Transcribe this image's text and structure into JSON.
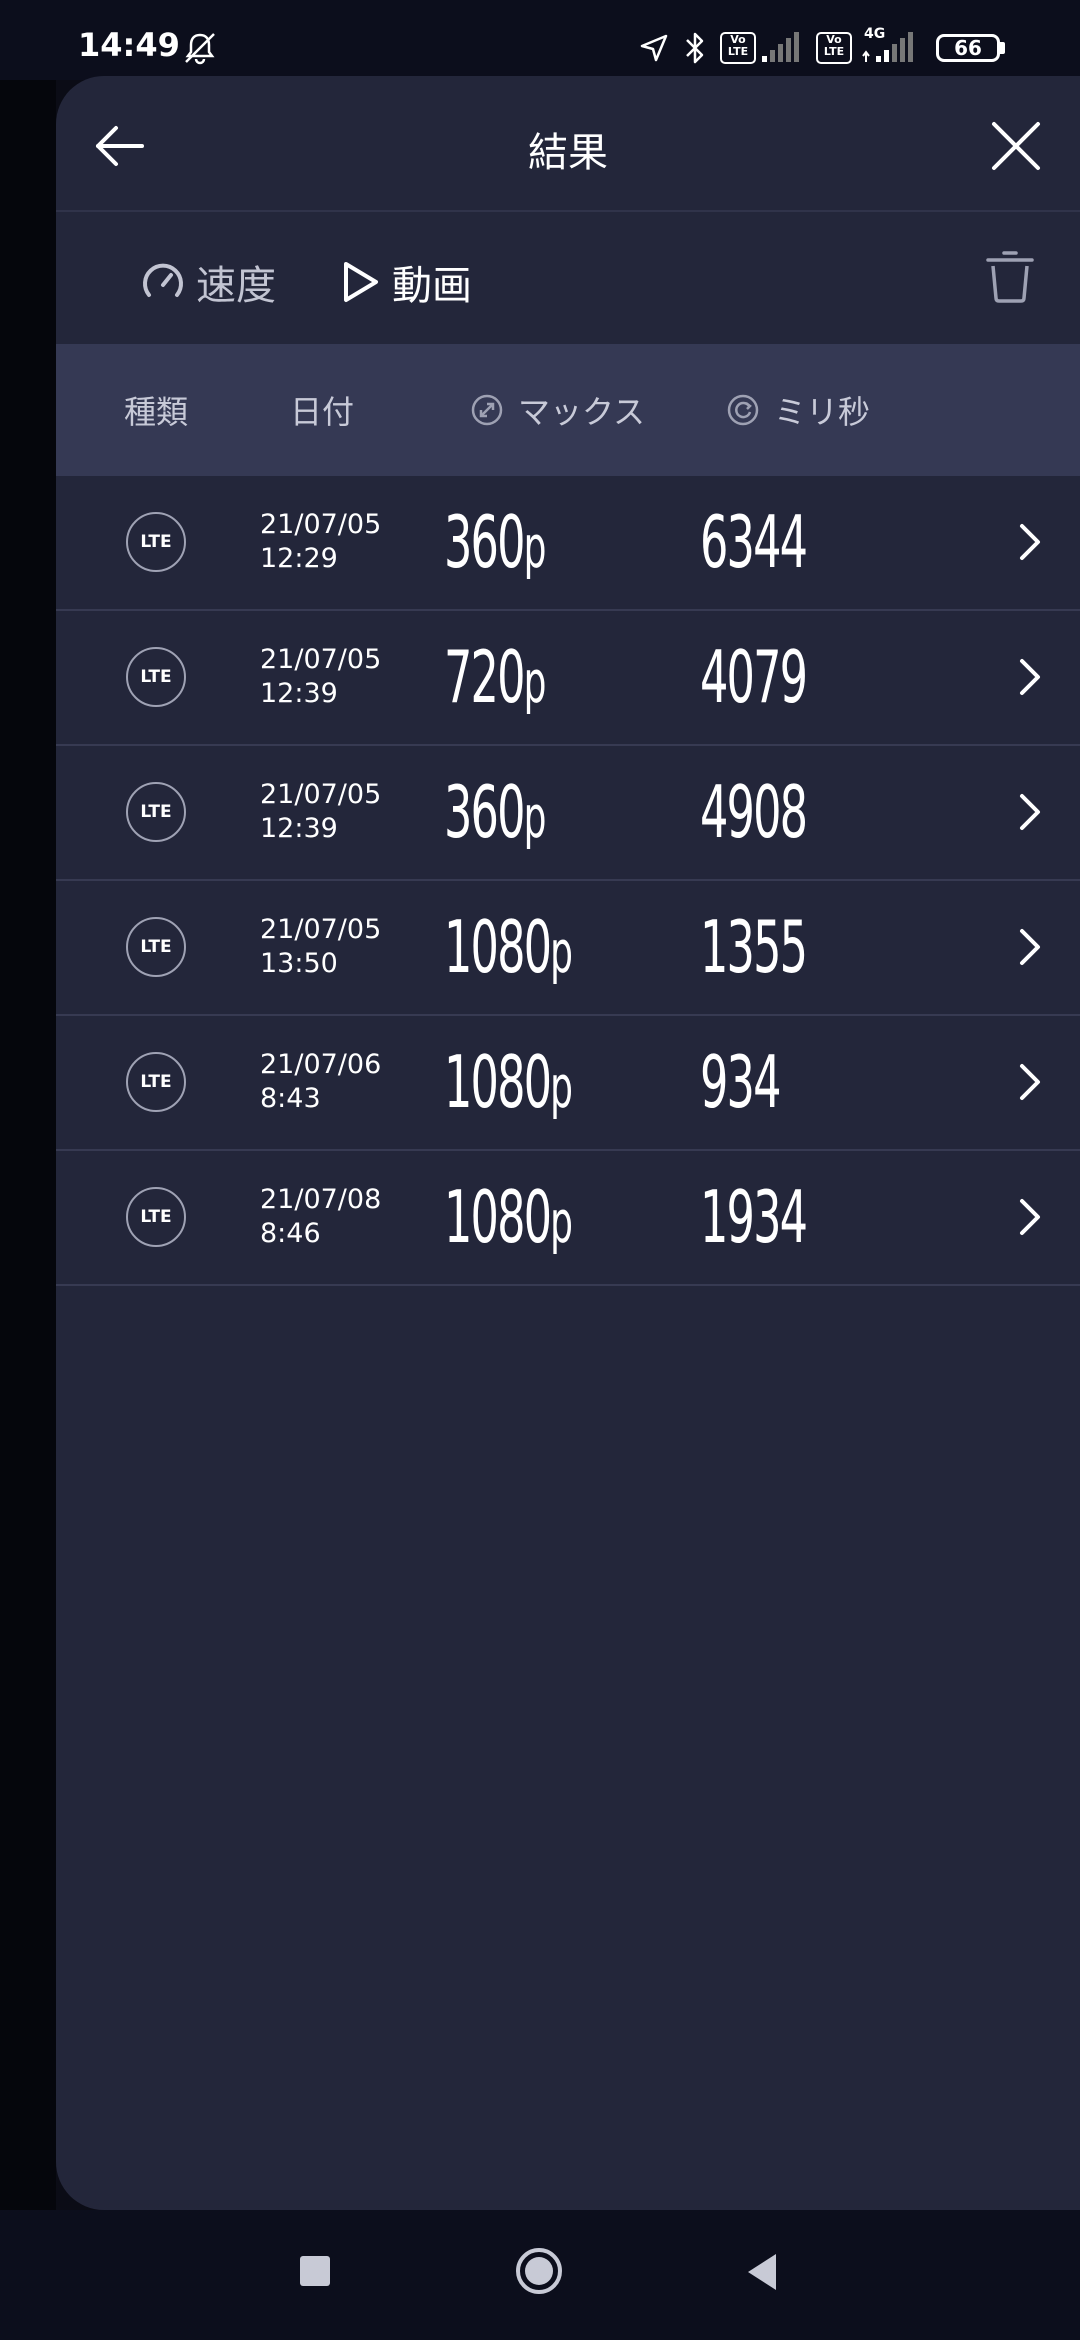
{
  "status_bar": {
    "time": "14:49",
    "battery": "66",
    "volte_label": "Vo LTE",
    "network": "4G"
  },
  "header": {
    "title": "結果"
  },
  "tabs": [
    {
      "label": "速度"
    },
    {
      "label": "動画"
    }
  ],
  "columns": {
    "type": "種類",
    "date": "日付",
    "max": "マックス",
    "ms": "ミリ秒"
  },
  "rows": [
    {
      "type": "LTE",
      "date": "21/07/05",
      "time": "12:29",
      "res": "360",
      "unit": "p",
      "ms": "6344"
    },
    {
      "type": "LTE",
      "date": "21/07/05",
      "time": "12:39",
      "res": "720",
      "unit": "p",
      "ms": "4079"
    },
    {
      "type": "LTE",
      "date": "21/07/05",
      "time": "12:39",
      "res": "360",
      "unit": "p",
      "ms": "4908"
    },
    {
      "type": "LTE",
      "date": "21/07/05",
      "time": "13:50",
      "res": "1080",
      "unit": "p",
      "ms": "1355"
    },
    {
      "type": "LTE",
      "date": "21/07/06",
      "time": "8:43",
      "res": "1080",
      "unit": "p",
      "ms": "934"
    },
    {
      "type": "LTE",
      "date": "21/07/08",
      "time": "8:46",
      "res": "1080",
      "unit": "p",
      "ms": "1934"
    }
  ],
  "colors": {
    "accent": "#1fc8ef",
    "panel": "#23263a",
    "header_row": "#353954"
  },
  "icons": {
    "back": "arrow-left-icon",
    "close": "close-icon",
    "speed": "gauge-icon",
    "video": "play-icon",
    "trash": "trash-icon",
    "chevron": "chevron-right-icon"
  }
}
